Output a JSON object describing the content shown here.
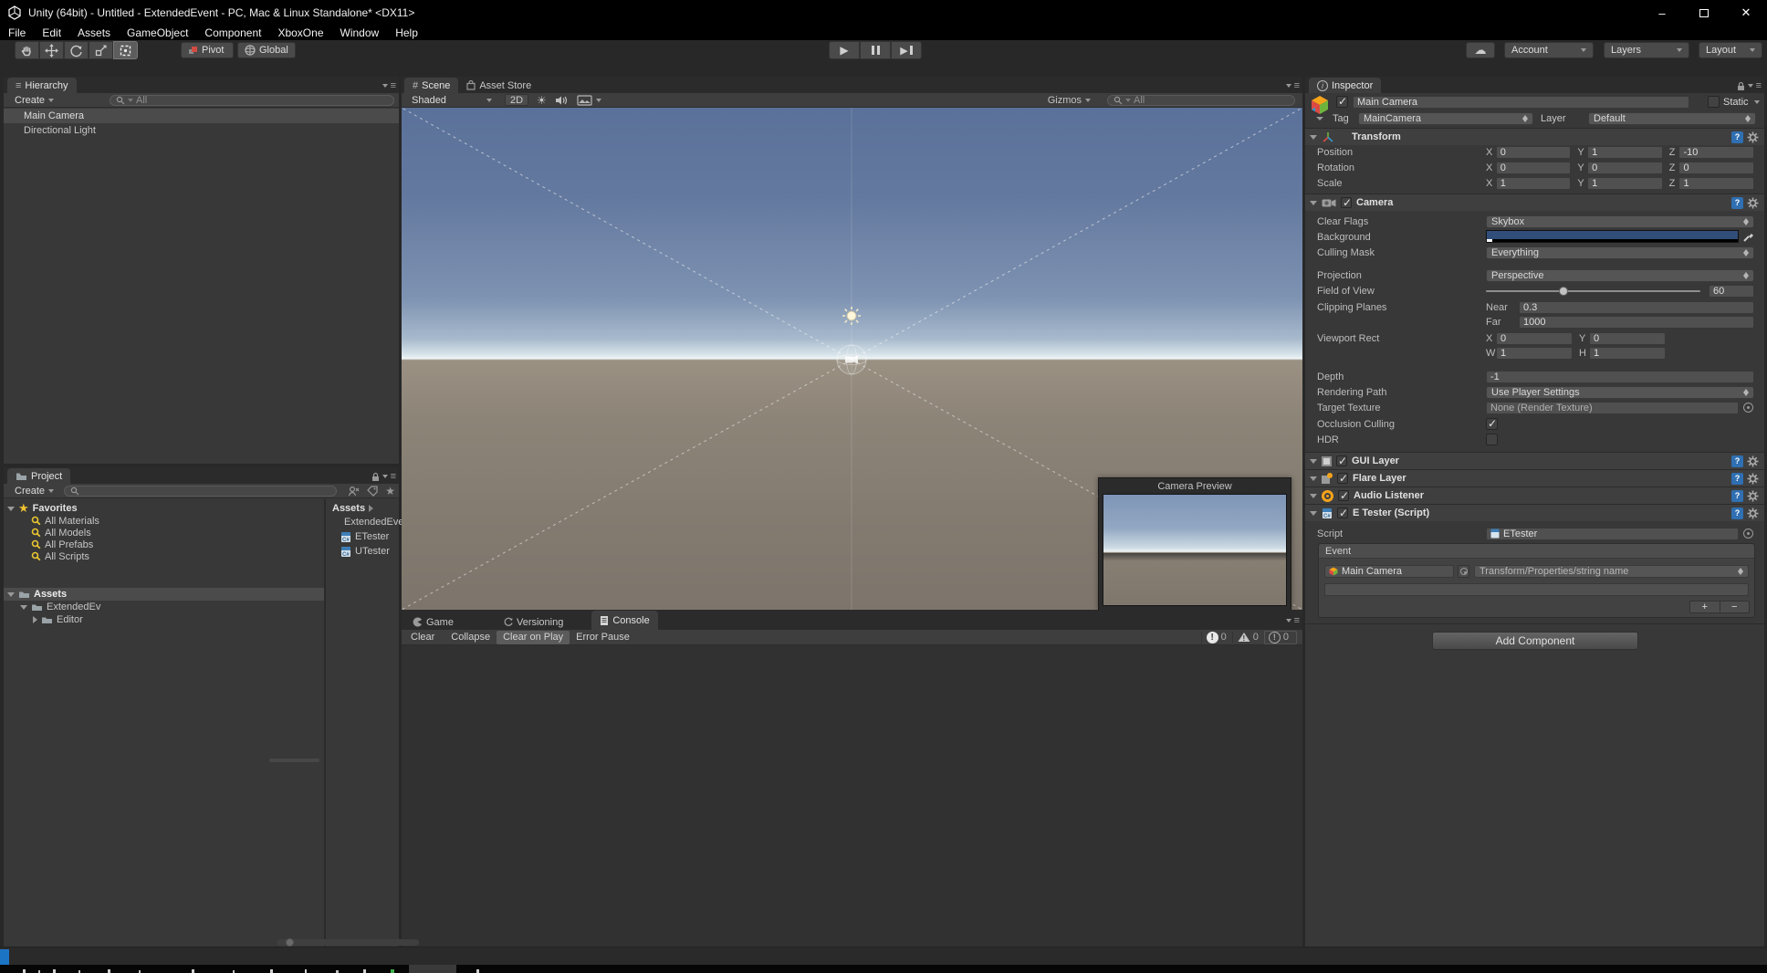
{
  "colors": {
    "camera_background_swatch": "#314d79",
    "status_accent_blue": "#1c74c4",
    "sky_top": "#5a7199",
    "horizon": "#edf4f5",
    "ground": "#8d8478"
  },
  "titlebar": {
    "title": "Unity (64bit) - Untitled - ExtendedEvent - PC, Mac & Linux Standalone* <DX11>"
  },
  "menubar": {
    "items": [
      "File",
      "Edit",
      "Assets",
      "GameObject",
      "Component",
      "XboxOne",
      "Window",
      "Help"
    ]
  },
  "toolbar": {
    "pivot_label": "Pivot",
    "global_label": "Global",
    "account_label": "Account",
    "layers_label": "Layers",
    "layout_label": "Layout"
  },
  "hierarchy": {
    "tab_label": "Hierarchy",
    "create_label": "Create",
    "search_placeholder": "All",
    "items": [
      {
        "label": "Main Camera"
      },
      {
        "label": "Directional Light"
      }
    ]
  },
  "project": {
    "tab_label": "Project",
    "create_label": "Create",
    "favorites_label": "Favorites",
    "favorites": [
      "All Materials",
      "All Models",
      "All Prefabs",
      "All Scripts"
    ],
    "assets_root_label": "Assets",
    "tree_child_label": "ExtendedEv",
    "tree_grandchild_label": "Editor",
    "breadcrumb_label": "Assets",
    "files": [
      {
        "name": "ExtendedEvent",
        "type": "folder"
      },
      {
        "name": "ETester",
        "type": "script"
      },
      {
        "name": "UTester",
        "type": "script"
      }
    ]
  },
  "scene": {
    "tab_label": "Scene",
    "asset_store_label": "Asset Store",
    "shaded_label": "Shaded",
    "two_d_label": "2D",
    "gizmos_label": "Gizmos",
    "search_placeholder": "All",
    "camera_preview_title": "Camera Preview"
  },
  "console": {
    "game_tab": "Game",
    "versioning_tab": "Versioning",
    "console_tab": "Console",
    "clear_label": "Clear",
    "collapse_label": "Collapse",
    "clear_on_play_label": "Clear on Play",
    "error_pause_label": "Error Pause",
    "info_count": "0",
    "warning_count": "0",
    "error_count": "0"
  },
  "inspector": {
    "tab_label": "Inspector",
    "header": {
      "name": "Main Camera",
      "static_label": "Static",
      "tag_label": "Tag",
      "tag_value": "MainCamera",
      "layer_label": "Layer",
      "layer_value": "Default"
    },
    "transform": {
      "title": "Transform",
      "rows": [
        {
          "label": "Position",
          "x_label": "X",
          "x": "0",
          "y_label": "Y",
          "y": "1",
          "z_label": "Z",
          "z": "-10"
        },
        {
          "label": "Rotation",
          "x_label": "X",
          "x": "0",
          "y_label": "Y",
          "y": "0",
          "z_label": "Z",
          "z": "0"
        },
        {
          "label": "Scale",
          "x_label": "X",
          "x": "1",
          "y_label": "Y",
          "y": "1",
          "z_label": "Z",
          "z": "1"
        }
      ]
    },
    "camera": {
      "title": "Camera",
      "clear_flags_label": "Clear Flags",
      "clear_flags_value": "Skybox",
      "background_label": "Background",
      "culling_mask_label": "Culling Mask",
      "culling_mask_value": "Everything",
      "projection_label": "Projection",
      "projection_value": "Perspective",
      "fov_label": "Field of View",
      "fov_value": "60",
      "clipping_label": "Clipping Planes",
      "near_label": "Near",
      "near_value": "0.3",
      "far_label": "Far",
      "far_value": "1000",
      "viewport_label": "Viewport Rect",
      "vx_label": "X",
      "vx": "0",
      "vy_label": "Y",
      "vy": "0",
      "vw_label": "W",
      "vw": "1",
      "vh_label": "H",
      "vh": "1",
      "depth_label": "Depth",
      "depth_value": "-1",
      "rendering_path_label": "Rendering Path",
      "rendering_path_value": "Use Player Settings",
      "target_texture_label": "Target Texture",
      "target_texture_value": "None (Render Texture)",
      "occlusion_label": "Occlusion Culling",
      "hdr_label": "HDR"
    },
    "gui_layer_title": "GUI Layer",
    "flare_layer_title": "Flare Layer",
    "audio_listener_title": "Audio Listener",
    "etester": {
      "title": "E Tester (Script)",
      "script_label": "Script",
      "script_value": "ETester",
      "event_title": "Event",
      "target_value": "Main Camera",
      "function_value": "Transform/Properties/string name",
      "add_label": "+",
      "remove_label": "−"
    },
    "add_component_label": "Add Component"
  }
}
